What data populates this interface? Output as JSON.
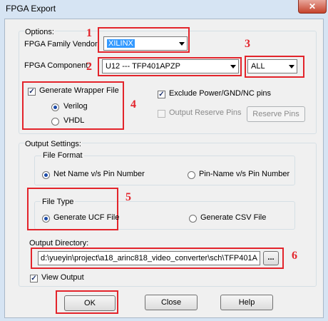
{
  "window": {
    "title": "FPGA Export",
    "close_glyph": "✕"
  },
  "options": {
    "group_label": "Options:",
    "vendor_label": "FPGA Family Vendor:",
    "vendor_value": "XILINX",
    "component_label": "FPGA Component:",
    "component_value": "U12 --- TFP401APZP",
    "filter_value": "ALL",
    "wrapper": {
      "label": "Generate Wrapper File",
      "checked": true,
      "verilog": "Verilog",
      "vhdl": "VHDL"
    },
    "exclude_pins": "Exclude Power/GND/NC pins",
    "output_reserve": "Output Reserve Pins",
    "reserve_pins_button": "Reserve Pins"
  },
  "output": {
    "group_label": "Output Settings:",
    "file_format_label": "File Format",
    "net_name": "Net Name v/s Pin Number",
    "pin_name": "Pin-Name v/s Pin Number",
    "file_type_label": "File Type",
    "ucf": "Generate UCF File",
    "csv": "Generate CSV File",
    "directory_label": "Output Directory:",
    "directory_value": "d:\\yueyin\\project\\a18_arinc818_video_converter\\sch\\TFP401A",
    "browse": "...",
    "view_output": "View Output"
  },
  "buttons": {
    "ok": "OK",
    "close": "Close",
    "help": "Help"
  },
  "annotations": [
    "1",
    "2",
    "3",
    "4",
    "5",
    "6"
  ],
  "colors": {
    "annotation": "#e3242b",
    "title_bar": "#d6e4f3",
    "dialog_bg": "#f0f0f0"
  }
}
